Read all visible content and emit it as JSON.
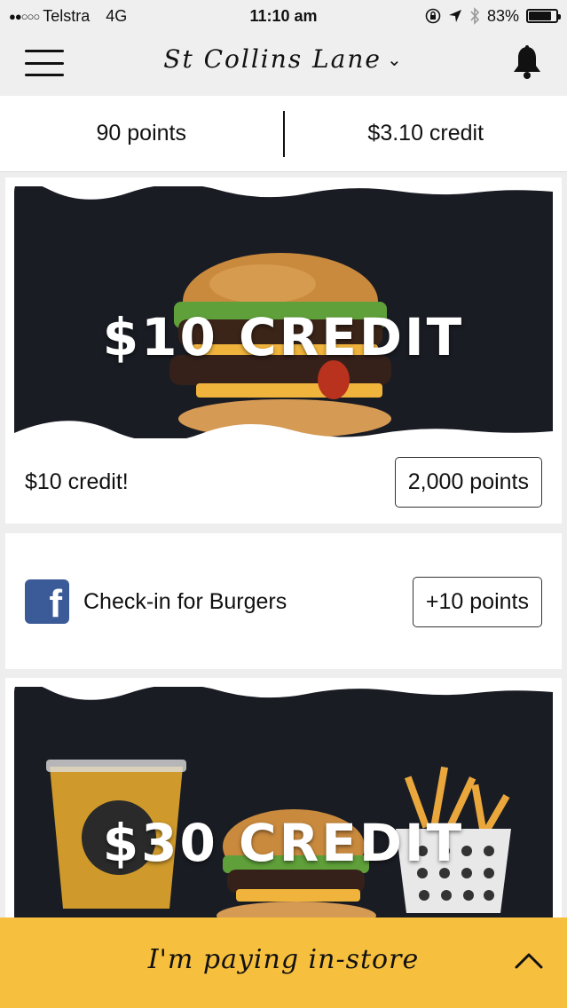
{
  "status_bar": {
    "carrier": "Telstra",
    "network": "4G",
    "time": "11:10 am",
    "battery": "83%",
    "battery_level": 0.83
  },
  "header": {
    "location": "St Collins Lane",
    "chevron": "⌄"
  },
  "summary": {
    "points": "90  points",
    "credit": "$3.10 credit"
  },
  "cards": [
    {
      "image_text": "$10 CREDIT",
      "title": "$10 credit!",
      "cost": "2,000 points"
    },
    {
      "title": "Check-in for Burgers",
      "reward": "+10 points",
      "icon": "facebook-icon"
    },
    {
      "image_text": "$30 CREDIT"
    }
  ],
  "bottom_bar": {
    "label": "I'm paying in-store"
  },
  "colors": {
    "accent": "#f6bf3e",
    "facebook": "#3b5a98",
    "image_bg": "#1a1c24"
  }
}
